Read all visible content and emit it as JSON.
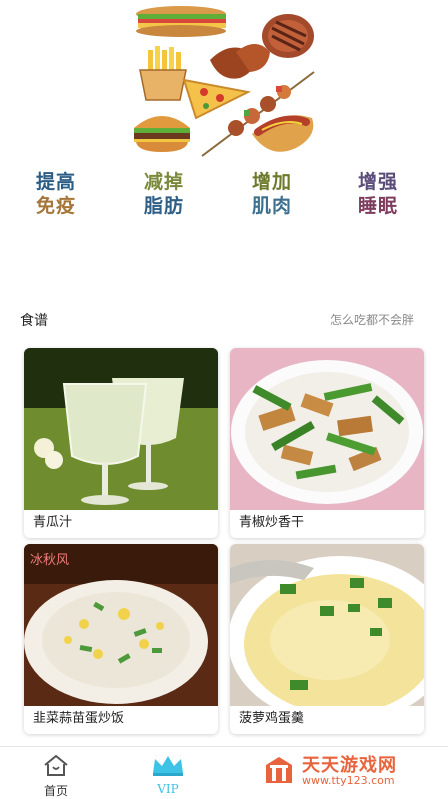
{
  "goals": [
    {
      "line1": "提高",
      "line2": "免疫",
      "c1": "#2a5d86",
      "c2": "#a5763a"
    },
    {
      "line1": "减掉",
      "line2": "脂肪",
      "c1": "#7a8a3a",
      "c2": "#2f5f87"
    },
    {
      "line1": "增加",
      "line2": "肌肉",
      "c1": "#6c7a2c",
      "c2": "#3d6f8e"
    },
    {
      "line1": "增强",
      "line2": "睡眠",
      "c1": "#5b4d7a",
      "c2": "#7d3d5e"
    }
  ],
  "section": {
    "title": "食谱",
    "subtitle": "怎么吃都不会胖"
  },
  "recipes": [
    {
      "name": "青瓜汁"
    },
    {
      "name": "青椒炒香干"
    },
    {
      "name": "韭菜蒜苗蛋炒饭",
      "watermark": "冰秋风"
    },
    {
      "name": "菠萝鸡蛋羹"
    }
  ],
  "tabs": [
    {
      "label": "首页",
      "icon": "home-icon",
      "color": "#333333"
    },
    {
      "label": "VIP",
      "icon": "crown-icon",
      "color": "#3cc3e6"
    }
  ],
  "watermark": {
    "title": "天天游戏网",
    "url": "www.tty123.com"
  },
  "colors": {
    "vip": "#3cc3e6",
    "watermark": "#e8643c"
  }
}
